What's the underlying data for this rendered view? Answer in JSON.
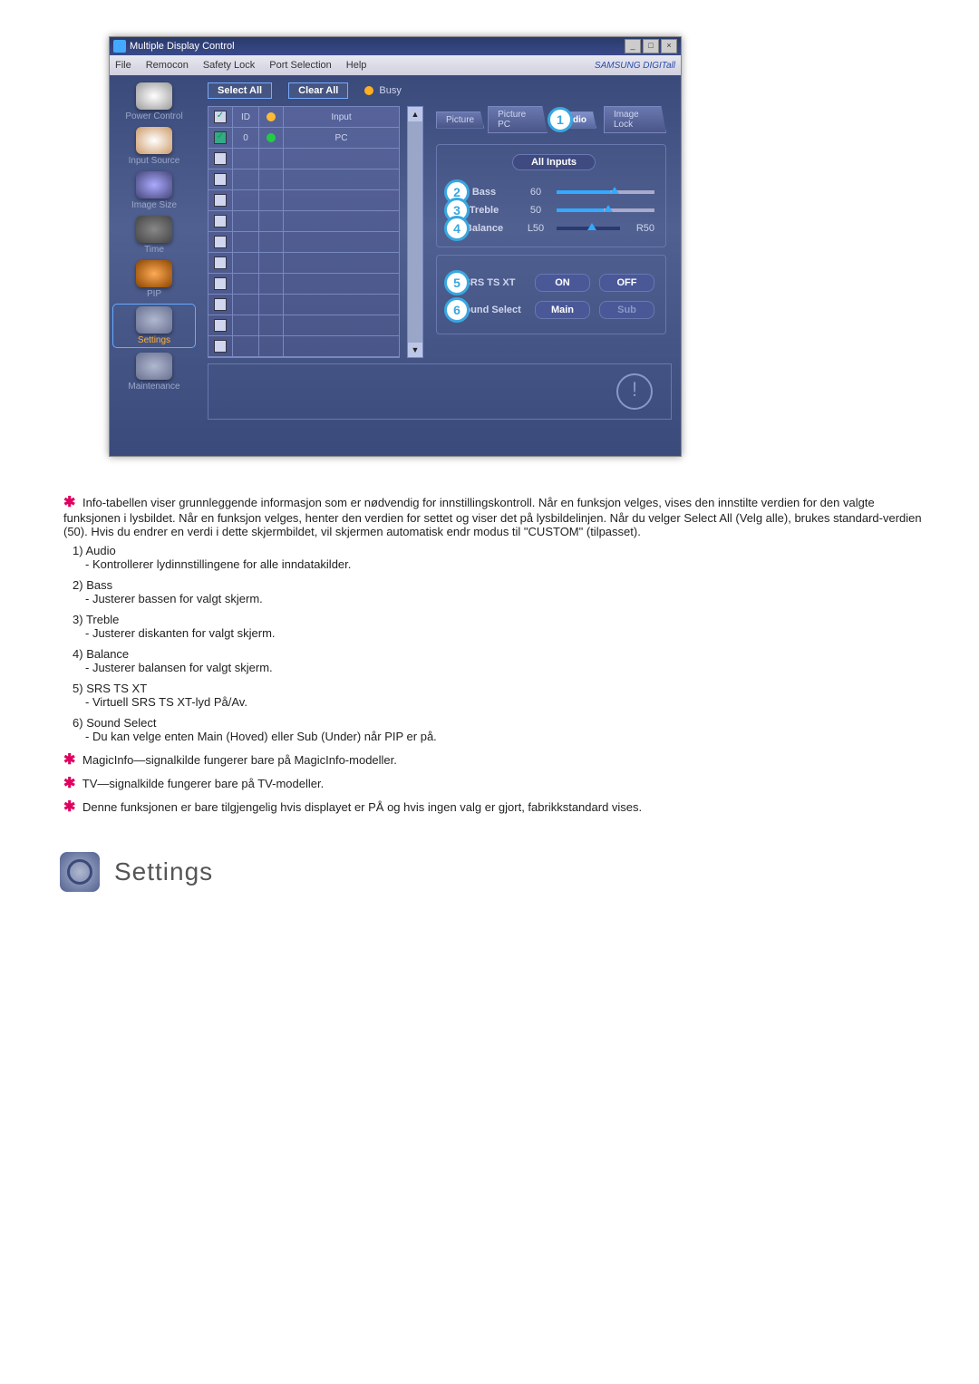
{
  "window": {
    "title": "Multiple Display Control",
    "menu": [
      "File",
      "Remocon",
      "Safety Lock",
      "Port Selection",
      "Help"
    ],
    "brand": "SAMSUNG DIGITall"
  },
  "sidebar": {
    "items": [
      {
        "label": "Power Control"
      },
      {
        "label": "Input Source"
      },
      {
        "label": "Image Size"
      },
      {
        "label": "Time"
      },
      {
        "label": "PIP"
      },
      {
        "label": "Settings"
      },
      {
        "label": "Maintenance"
      }
    ]
  },
  "toolbar": {
    "select_all": "Select All",
    "clear_all": "Clear All",
    "busy": "Busy"
  },
  "grid": {
    "headers": {
      "cb": "☑",
      "id": "ID",
      "status": "●",
      "input": "Input"
    },
    "row0": {
      "id": "0",
      "input": "PC"
    }
  },
  "tabs": {
    "picture": "Picture",
    "picture_pc": "Picture PC",
    "audio": "Audio",
    "image_lock": "Image Lock"
  },
  "audio_panel": {
    "all_inputs": "All Inputs",
    "bass": {
      "label": "Bass",
      "value": "60"
    },
    "treble": {
      "label": "Treble",
      "value": "50"
    },
    "balance": {
      "label": "Balance",
      "left": "L50",
      "right": "R50"
    },
    "srs": {
      "label": "SRS TS XT",
      "on": "ON",
      "off": "OFF"
    },
    "sound_select": {
      "label": "Sound Select",
      "main": "Main",
      "sub": "Sub"
    }
  },
  "badges": {
    "b1": "1",
    "b2": "2",
    "b3": "3",
    "b4": "4",
    "b5": "5",
    "b6": "6"
  },
  "body": {
    "intro": "Info-tabellen viser grunnleggende informasjon som er nødvendig for innstillingskontroll. Når en funksjon velges, vises den innstilte verdien for den valgte funksjonen i lysbildet. Når en funksjon velges, henter den verdien for settet og viser det på lysbildelinjen. Når du velger Select All (Velg alle), brukes standard-verdien (50). Hvis du endrer en verdi i dette skjermbildet, vil skjermen automatisk endr modus til \"CUSTOM\" (tilpasset).",
    "items": [
      {
        "n": "1)",
        "title": "Audio",
        "desc": "- Kontrollerer lydinnstillingene for alle inndatakilder."
      },
      {
        "n": "2)",
        "title": "Bass",
        "desc": "- Justerer bassen for valgt skjerm."
      },
      {
        "n": "3)",
        "title": "Treble",
        "desc": "- Justerer diskanten for valgt skjerm."
      },
      {
        "n": "4)",
        "title": "Balance",
        "desc": "- Justerer balansen for valgt skjerm."
      },
      {
        "n": "5)",
        "title": "SRS TS XT",
        "desc": "- Virtuell SRS TS XT-lyd På/Av."
      },
      {
        "n": "6)",
        "title": "Sound Select",
        "desc": "- Du kan velge enten Main (Hoved) eller Sub (Under) når PIP er på."
      }
    ],
    "notes": [
      "MagicInfo—signalkilde fungerer bare på MagicInfo-modeller.",
      "TV—signalkilde fungerer bare på TV-modeller.",
      "Denne funksjonen er bare tilgjengelig hvis displayet er PÅ og hvis ingen valg er gjort, fabrikkstandard vises."
    ],
    "settings_heading": "Settings"
  }
}
